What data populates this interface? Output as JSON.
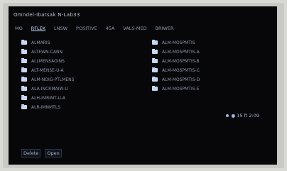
{
  "window": {
    "title": "Omndel-Ibatsak N-Lab33"
  },
  "tabs": [
    {
      "label": "MO",
      "active": false
    },
    {
      "label": "RFLEK",
      "active": true
    },
    {
      "label": "LNSW",
      "active": false
    },
    {
      "label": "POSITIVE",
      "active": false
    },
    {
      "label": "45A",
      "active": false
    },
    {
      "label": "VALS-MED",
      "active": false
    },
    {
      "label": "BRIWER",
      "active": false
    }
  ],
  "lists": {
    "left": [
      {
        "label": "ALMARIS",
        "icon": "folder-icon"
      },
      {
        "label": "ALTEWN-CANN",
        "icon": "folder-icon"
      },
      {
        "label": "ALLMENSAOINS",
        "icon": "folder-icon"
      },
      {
        "label": "ALT-MENSE-U-A",
        "icon": "folder-icon"
      },
      {
        "label": "ALM-NOIG-PTLMENS",
        "icon": "folder-icon"
      },
      {
        "label": "ALA-INCRMAIW-U",
        "icon": "folder-icon"
      },
      {
        "label": "ALH-IMRIMT-U-A",
        "icon": "folder-icon"
      },
      {
        "label": "ALR-IMNMTLS",
        "icon": "folder-icon"
      }
    ],
    "right": [
      {
        "label": "ALM-MOSPMTIS",
        "icon": "folder-icon"
      },
      {
        "label": "ALM-MOSPMTIS-A",
        "icon": "folder-icon"
      },
      {
        "label": "ALM-MOSPMTIS-B",
        "icon": "folder-icon"
      },
      {
        "label": "ALM-MOSPMTIS-C",
        "icon": "folder-icon"
      },
      {
        "label": "ALM-MOSPMTIS-D",
        "icon": "folder-icon"
      },
      {
        "label": "ALM-MOSPMTIS-E",
        "icon": "folder-icon"
      }
    ]
  },
  "status": {
    "text": "● 15 ft 2:09"
  },
  "footer": {
    "left_label": "Delete",
    "right_label": "Open"
  },
  "colors": {
    "screen_bg": "#07070a",
    "text": "#9aa6b6",
    "accent": "#cfe1ff"
  }
}
